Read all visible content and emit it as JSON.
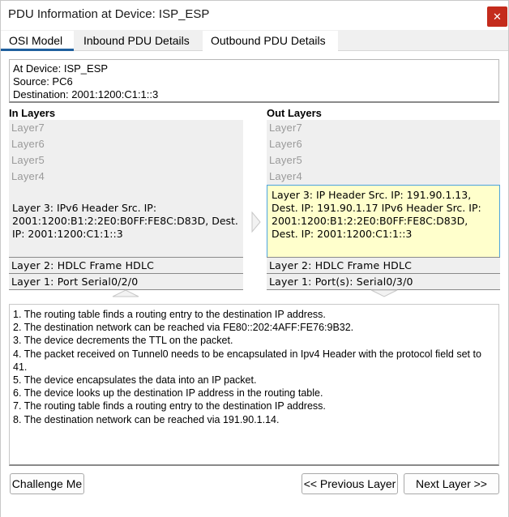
{
  "window": {
    "title": "PDU Information at Device: ISP_ESP",
    "close_glyph": "✕"
  },
  "tabs": [
    {
      "label": "OSI Model",
      "active": true
    },
    {
      "label": "Inbound PDU Details",
      "active": false
    },
    {
      "label": "Outbound PDU Details",
      "active": false
    }
  ],
  "info": {
    "device": "At Device: ISP_ESP",
    "source": "Source: PC6",
    "destination": "Destination: 2001:1200:C1:1::3"
  },
  "in_layers": {
    "header": "In Layers",
    "layer7": "Layer7",
    "layer6": "Layer6",
    "layer5": "Layer5",
    "layer4": "Layer4",
    "layer3": "Layer 3: IPv6 Header Src. IP: 2001:1200:B1:2:2E0:B0FF:FE8C:D83D, Dest. IP: 2001:1200:C1:1::3",
    "layer2": "Layer 2: HDLC Frame HDLC",
    "layer1": "Layer 1: Port Serial0/2/0"
  },
  "out_layers": {
    "header": "Out Layers",
    "layer7": "Layer7",
    "layer6": "Layer6",
    "layer5": "Layer5",
    "layer4": "Layer4",
    "layer3": "Layer 3: IP Header Src. IP: 191.90.1.13, Dest. IP: 191.90.1.17 IPv6 Header Src. IP: 2001:1200:B1:2:2E0:B0FF:FE8C:D83D, Dest. IP: 2001:1200:C1:1::3",
    "layer2": "Layer 2: HDLC Frame HDLC",
    "layer1": "Layer 1: Port(s): Serial0/3/0"
  },
  "steps": [
    "1. The routing table finds a routing entry to the destination IP address.",
    "2. The destination network can be reached via FE80::202:4AFF:FE76:9B32.",
    "3. The device decrements the TTL on the packet.",
    "4. The packet received on Tunnel0 needs to be encapsulated in Ipv4 Header with the protocol field set to 41.",
    "5. The device encapsulates the data into an IP packet.",
    "6. The device looks up the destination IP address in the routing table.",
    "7. The routing table finds a routing entry to the destination IP address.",
    "8. The destination network can be reached via 191.90.1.14."
  ],
  "buttons": {
    "challenge": "Challenge Me",
    "previous": "<< Previous Layer",
    "next": "Next Layer >>"
  },
  "colors": {
    "active_tab_underline": "#1f5f9e",
    "highlight_fill": "#ffffcc",
    "highlight_border": "#4aa3df",
    "close_button": "#c42b1c"
  }
}
